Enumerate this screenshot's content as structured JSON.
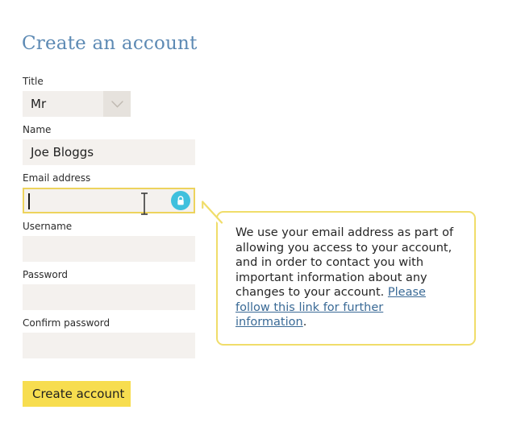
{
  "page": {
    "title": "Create an account",
    "background_color": "#ffffff",
    "title_color": "#5d8ab4"
  },
  "form": {
    "fields": [
      {
        "label": "Title",
        "type": "select",
        "value": "Mr",
        "placeholder": "",
        "icon": "chevron-down-icon"
      },
      {
        "label": "Name",
        "type": "text",
        "value": "Joe Bloggs",
        "placeholder": ""
      },
      {
        "label": "Email address",
        "type": "email",
        "value": "",
        "placeholder": "",
        "focused": true,
        "icon": "lock-icon",
        "icon_color": "#3fc0dd",
        "focus_border_color": "#edd35d"
      },
      {
        "label": "Username",
        "type": "text",
        "value": "",
        "placeholder": ""
      },
      {
        "label": "Password",
        "type": "password",
        "value": "",
        "placeholder": ""
      },
      {
        "label": "Confirm password",
        "type": "password",
        "value": "",
        "placeholder": ""
      }
    ],
    "submit_label": "Create account",
    "submit_color": "#f7dd4f"
  },
  "tooltip": {
    "text_before_link": "We use your email address as part of allowing you access to your account, and in order to contact you with important information about any changes to your account. ",
    "link_text": "Please follow this link for further information",
    "text_after_link": ".",
    "border_color": "#f0dd6a",
    "link_color": "#3a6a96"
  },
  "cursor": {
    "type": "ibeam-cursor"
  }
}
